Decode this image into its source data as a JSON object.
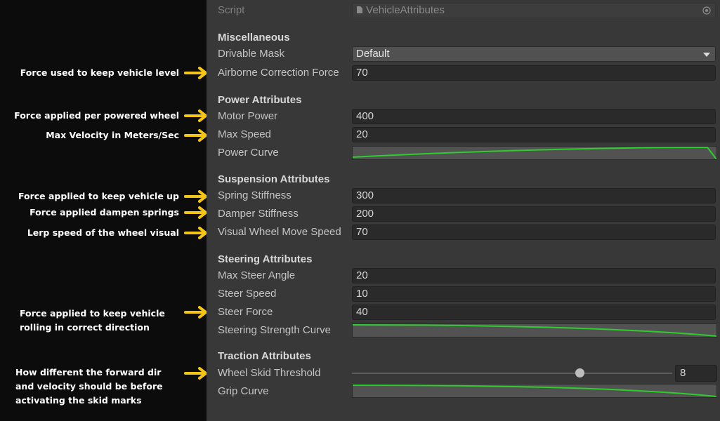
{
  "annotations": {
    "airborne": "Force used to keep vehicle level",
    "motor": "Force applied per powered wheel",
    "maxspeed": "Max Velocity in Meters/Sec",
    "spring": "Force applied to keep vehicle up",
    "damper": "Force applied dampen springs",
    "wheelvisual": "Lerp speed of the wheel visual",
    "steer_line1": "Force applied to keep vehicle",
    "steer_line2": "rolling in correct direction",
    "skid_line1": "How different the forward dir",
    "skid_line2": "and velocity should be before",
    "skid_line3": "activating the skid marks"
  },
  "colors": {
    "annotation_arrow": "#f5c518",
    "curve": "#2ecc2e",
    "panel": "#383838"
  },
  "script": {
    "label": "Script",
    "value": "VehicleAttributes",
    "file_icon": "script-file-icon",
    "picker_icon": "object-picker-icon"
  },
  "misc": {
    "header": "Miscellaneous",
    "drivable_mask": {
      "label": "Drivable Mask",
      "value": "Default"
    },
    "airborne": {
      "label": "Airborne Correction Force",
      "value": "70"
    }
  },
  "power": {
    "header": "Power Attributes",
    "motor_power": {
      "label": "Motor Power",
      "value": "400"
    },
    "max_speed": {
      "label": "Max Speed",
      "value": "20"
    },
    "power_curve": {
      "label": "Power Curve"
    }
  },
  "suspension": {
    "header": "Suspension Attributes",
    "spring": {
      "label": "Spring Stiffness",
      "value": "300"
    },
    "damper": {
      "label": "Damper Stiffness",
      "value": "200"
    },
    "wheel_move": {
      "label": "Visual Wheel Move Speed",
      "value": "70"
    }
  },
  "steering": {
    "header": "Steering Attributes",
    "max_angle": {
      "label": "Max Steer Angle",
      "value": "20"
    },
    "speed": {
      "label": "Steer Speed",
      "value": "10"
    },
    "force": {
      "label": "Steer Force",
      "value": "40"
    },
    "curve": {
      "label": "Steering Strength Curve"
    }
  },
  "traction": {
    "header": "Traction Attributes",
    "skid": {
      "label": "Wheel Skid Threshold",
      "value": "8",
      "fraction": 0.71
    },
    "grip": {
      "label": "Grip Curve"
    }
  }
}
